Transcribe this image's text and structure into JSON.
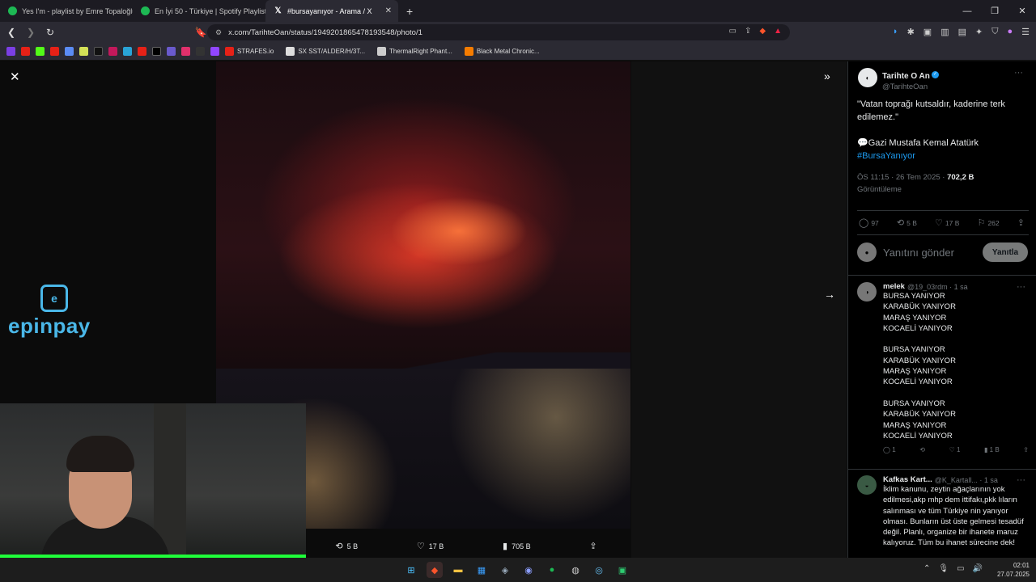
{
  "tabs": [
    {
      "title": "Yes I'm - playlist by Emre Topaloğlu |"
    },
    {
      "title": "En İyi 50 - Türkiye | Spotify Playlist"
    },
    {
      "title": "#bursayanıyor - Arama / X"
    }
  ],
  "address": {
    "url": "x.com/TarihteOan/status/1949201865478193548/photo/1"
  },
  "bookmarks": [
    {
      "label": "STRAFES.io"
    },
    {
      "label": "SX SST/ALDER/H/3T..."
    },
    {
      "label": "ThermalRight Phant..."
    },
    {
      "label": "Black Metal Chronic..."
    }
  ],
  "photo_actions": {
    "retweets": "5 B",
    "likes": "17 B",
    "views": "705 B"
  },
  "overlay_brand": {
    "name": "epinpay"
  },
  "tweet": {
    "display_name": "Tarihte O An",
    "handle": "@TarihteOan",
    "line1": "\"Vatan toprağı kutsaldır, kaderine terk edilemez.\"",
    "line2": "💬Gazi Mustafa Kemal Atatürk",
    "hashtag": "#BursaYanıyor",
    "timestamp": "ÖS 11:15 · 26 Tem 2025 · ",
    "views_count": "702,2 B",
    "views_label": "Görüntüleme",
    "replies": "97",
    "retweets": "5 B",
    "likes": "17 B",
    "bookmarks": "262"
  },
  "reply_box": {
    "placeholder": "Yanıtını gönder",
    "button": "Yanıtla"
  },
  "replies": [
    {
      "name": "melek",
      "handle": "@19_03rdm · 1 sa",
      "text": "BURSA YANIYOR\nKARABÜK YANIYOR\nMARAŞ YANIYOR\nKOCAELİ YANIYOR\n\nBURSA YANIYOR\nKARABÜK YANIYOR\nMARAŞ YANIYOR\nKOCAELİ YANIYOR\n\nBURSA YANIYOR\nKARABÜK YANIYOR\nMARAŞ YANIYOR\nKOCAELİ YANIYOR",
      "reply_count": "1",
      "like_count": "1",
      "view_count": "1 B"
    },
    {
      "name": "Kafkas Kart...",
      "handle": "@K_Kartall... · 1 sa",
      "text": "İklim kanunu, zeytin ağaçlarının yok edilmesi,akp mhp dem ittifakı,pkk lıların salınması ve tüm Türkiye nin yanıyor olması. Bunların üst üste gelmesi tesadüf değil. Planlı, organize bir ihanete maruz kalıyoruz. Tüm bu ihanet sürecine dek!"
    }
  ],
  "clock": {
    "time": "02:01",
    "date": "27.07.2025"
  }
}
